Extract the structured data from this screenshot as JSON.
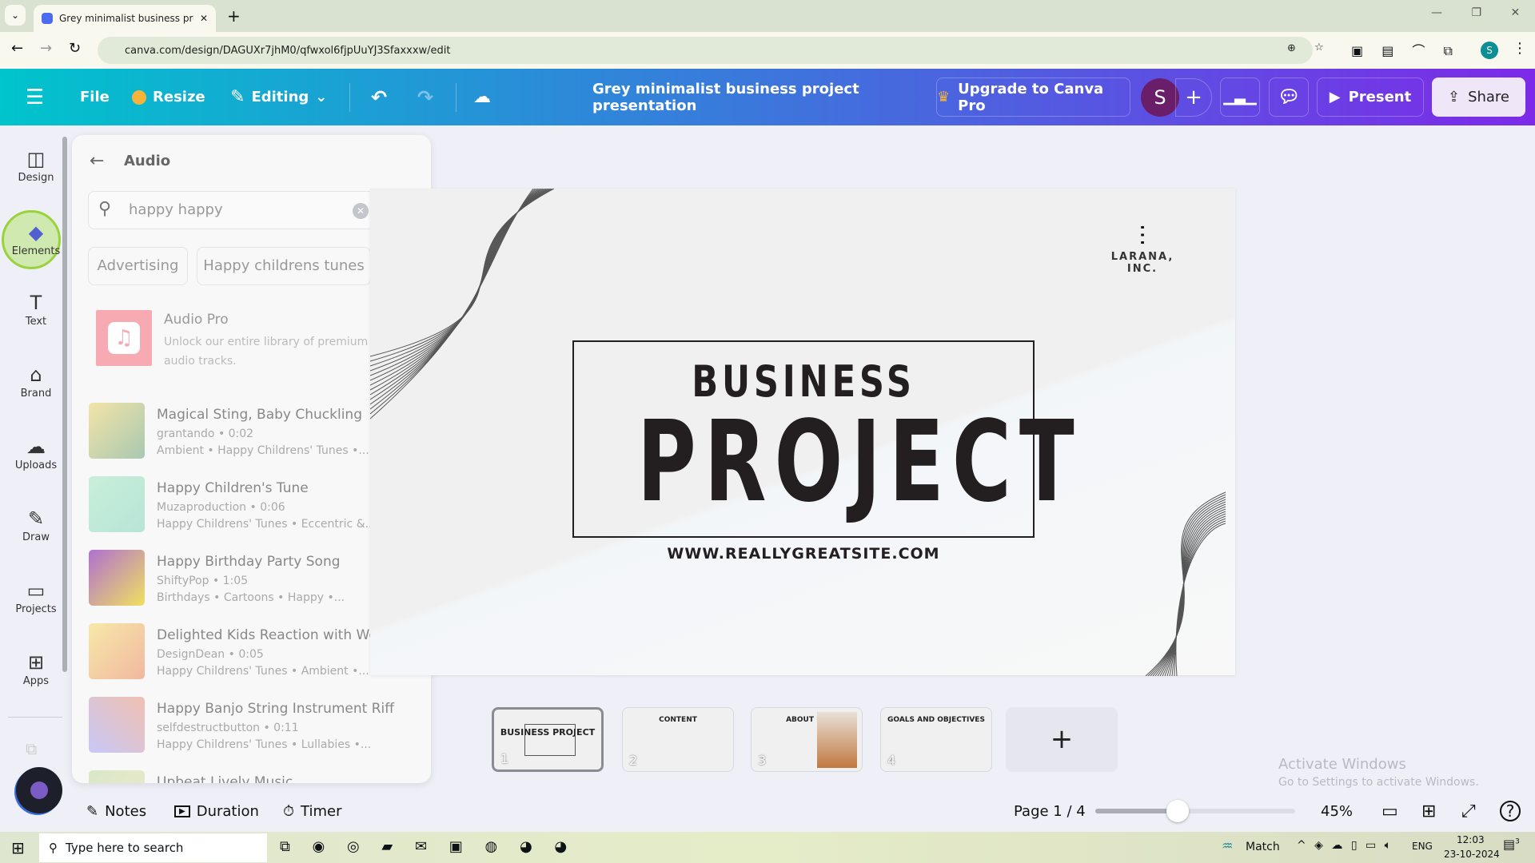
{
  "browser": {
    "tab_title": "Grey minimalist business projec",
    "url": "canva.com/design/DAGUXr7jhM0/qfwxol6fjpUuYJ3Sfaxxxw/edit",
    "profile_initial": "S"
  },
  "toolbar": {
    "file": "File",
    "resize": "Resize",
    "editing": "Editing",
    "doc_title": "Grey minimalist business project presentation",
    "upgrade": "Upgrade to Canva Pro",
    "avatar": "S",
    "present": "Present",
    "share": "Share",
    "accent": "#7d2ae8"
  },
  "rail": [
    {
      "label": "Design",
      "icon": "design-icon"
    },
    {
      "label": "Elements",
      "icon": "elements-icon"
    },
    {
      "label": "Text",
      "icon": "text-icon"
    },
    {
      "label": "Brand",
      "icon": "brand-icon"
    },
    {
      "label": "Uploads",
      "icon": "uploads-icon"
    },
    {
      "label": "Draw",
      "icon": "draw-icon"
    },
    {
      "label": "Projects",
      "icon": "projects-icon"
    },
    {
      "label": "Apps",
      "icon": "apps-icon"
    }
  ],
  "panel": {
    "title": "Audio",
    "search_value": "happy happy",
    "chips": [
      "Advertising",
      "Happy childrens tunes"
    ],
    "pro": {
      "title": "Audio Pro",
      "desc": "Unlock our entire library of premium audio tracks."
    },
    "tracks": [
      {
        "title": "Magical Sting, Baby Chuckling",
        "meta": "grantando • 0:02",
        "tags": "Ambient • Happy Childrens' Tunes •..."
      },
      {
        "title": "Happy Children's Tune",
        "meta": "Muzaproduction • 0:06",
        "tags": "Happy Childrens' Tunes • Eccentric &..."
      },
      {
        "title": "Happy Birthday Party Song",
        "meta": "ShiftyPop • 1:05",
        "tags": "Birthdays • Cartoons • Happy •..."
      },
      {
        "title": "Delighted Kids Reaction with Wow",
        "meta": "DesignDean • 0:05",
        "tags": "Happy Childrens' Tunes • Ambient •..."
      },
      {
        "title": "Happy Banjo String Instrument Riff",
        "meta": "selfdestructbutton • 0:11",
        "tags": "Happy Childrens' Tunes • Lullabies •..."
      },
      {
        "title": "Upbeat Lively Music",
        "meta": "",
        "tags": ""
      }
    ]
  },
  "slide": {
    "logo": "LARANA, INC.",
    "line1": "BUSINESS",
    "line2": "PROJECT",
    "site": "WWW.REALLYGREATSITE.COM"
  },
  "thumbs": [
    {
      "n": "1",
      "title": "BUSINESS PROJECT"
    },
    {
      "n": "2",
      "title": "CONTENT"
    },
    {
      "n": "3",
      "title": "ABOUT US"
    },
    {
      "n": "4",
      "title": "GOALS AND OBJECTIVES"
    }
  ],
  "bottom": {
    "notes": "Notes",
    "duration": "Duration",
    "timer": "Timer",
    "page": "Page 1 / 4",
    "zoom": "45%",
    "zoom_percent": 45
  },
  "watermark": {
    "title": "Activate Windows",
    "sub": "Go to Settings to activate Windows."
  },
  "taskbar": {
    "search": "Type here to search",
    "weather": "Match",
    "lang": "ENG",
    "time": "12:03",
    "date": "23-10-2024",
    "notif": "3"
  }
}
